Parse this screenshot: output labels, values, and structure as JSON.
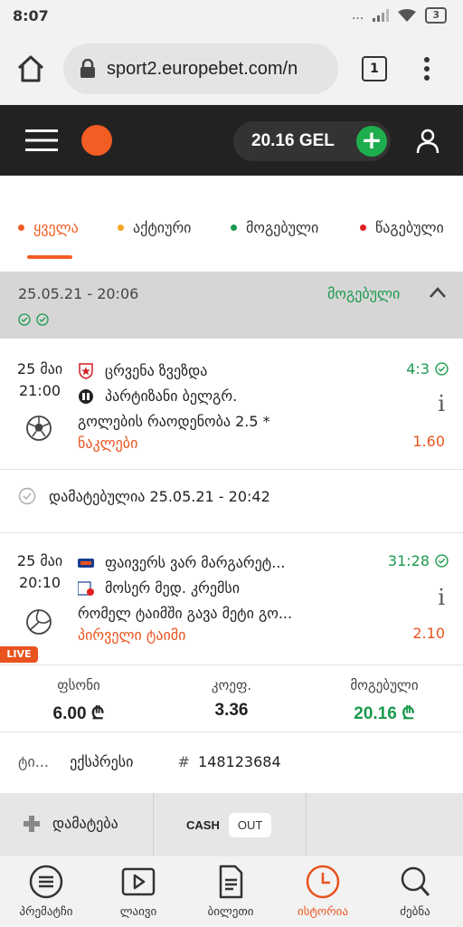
{
  "status_bar": {
    "time": "8:07",
    "signal_text": "...",
    "battery": "3"
  },
  "browser": {
    "url": "sport2.europebet.com/n",
    "tab_count": "1"
  },
  "header": {
    "balance": "20.16 GEL",
    "add_label": "+"
  },
  "filters": [
    {
      "label": "ყველა",
      "color": "#f25d23",
      "active": true
    },
    {
      "label": "აქტიური",
      "color": "#f5a623",
      "active": false
    },
    {
      "label": "მოგებული",
      "color": "#1a9a4e",
      "active": false
    },
    {
      "label": "წაგებული",
      "color": "#e02020",
      "active": false
    }
  ],
  "bet": {
    "date": "25.05.21 - 20:06",
    "status": "მოგებული",
    "events": [
      {
        "date_line1": "25 მაი",
        "date_line2": "21:00",
        "team1": "ცრვენა ზვეზდა",
        "team2": "პარტიზანი ბელგრ.",
        "score": "4:3",
        "market": "გოლების რაოდენობა 2.5 *",
        "selection": "ნაკლები",
        "odd": "1.60",
        "sport_icon": "soccer-ball-icon"
      },
      {
        "date_line1": "25 მაი",
        "date_line2": "20:10",
        "team1": "ფაივერს ვარ მარგარეტ...",
        "team2": "მოსერ მედ. კრემსი",
        "score": "31:28",
        "market": "რომელ ტაიმში გავა მეტი გო...",
        "selection": "პირველი ტაიმი",
        "odd": "2.10",
        "sport_icon": "volleyball-icon",
        "live": "LIVE"
      }
    ],
    "added_text": "დამატებულია 25.05.21 - 20:42",
    "summary": {
      "stake_label": "ფსონი",
      "stake_value": "6.00 ₾",
      "odds_label": "კოეფ.",
      "odds_value": "3.36",
      "win_label": "მოგებული",
      "win_value": "20.16 ₾"
    },
    "type_label": "ტი...",
    "type_value": "ექსპრესი",
    "id_prefix": "#",
    "id_value": "148123684"
  },
  "actions": {
    "add_label": "დამატება",
    "cash_label": "CASH",
    "out_label": "OUT"
  },
  "bottom_nav": [
    {
      "label": "პრემატჩი",
      "icon": "list-circle-icon"
    },
    {
      "label": "ლაივი",
      "icon": "play-screen-icon"
    },
    {
      "label": "ბილეთი",
      "icon": "ticket-icon"
    },
    {
      "label": "ისტორია",
      "icon": "clock-icon",
      "active": true
    },
    {
      "label": "ძებნა",
      "icon": "search-icon"
    }
  ],
  "colors": {
    "accent": "#f25d23",
    "win": "#1a9a4e",
    "header_bg": "#222222"
  }
}
